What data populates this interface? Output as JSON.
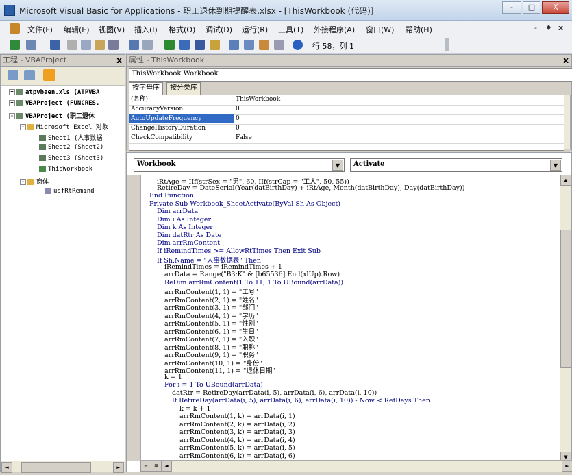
{
  "window": {
    "title": "Microsoft Visual Basic for Applications - 职工退休到期提醒表.xlsx - [ThisWorkbook (代码)]",
    "minimize": "-",
    "maximize": "□",
    "close": "X"
  },
  "menu": {
    "items": [
      "文件(F)",
      "编辑(E)",
      "视图(V)",
      "插入(I)",
      "格式(O)",
      "调试(D)",
      "运行(R)",
      "工具(T)",
      "外接程序(A)",
      "窗口(W)",
      "帮助(H)"
    ],
    "mdi_min": "-",
    "mdi_restore": "♦",
    "mdi_close": "x"
  },
  "toolbar": {
    "position_text": "行 58，列 1"
  },
  "project": {
    "header": "工程 - VBAProject",
    "close": "x",
    "nodes": [
      {
        "text": "atpvbaen.xls (ATPVBA",
        "bold": true
      },
      {
        "text": "VBAProject (FUNCRES.",
        "bold": true
      },
      {
        "text": "VBAProject (职工退休",
        "bold": true
      },
      {
        "text": "Microsoft Excel 对象",
        "bold": false
      },
      {
        "text": "Sheet1 (人事数据",
        "bold": false
      },
      {
        "text": "Sheet2 (Sheet2)",
        "bold": false
      },
      {
        "text": "Sheet3 (Sheet3)",
        "bold": false
      },
      {
        "text": "ThisWorkbook",
        "bold": false
      },
      {
        "text": "窗体",
        "bold": false
      },
      {
        "text": "usfRtRemind",
        "bold": false
      }
    ]
  },
  "properties": {
    "header": "属性 - ThisWorkbook",
    "close": "x",
    "object": "ThisWorkbook Workbook",
    "tabs": [
      "按字母序",
      "按分类序"
    ],
    "rows": [
      {
        "key": "(名称)",
        "value": "ThisWorkbook"
      },
      {
        "key": "AccuracyVersion",
        "value": "0"
      },
      {
        "key": "AutoUpdateFrequency",
        "value": "0"
      },
      {
        "key": "ChangeHistoryDuration",
        "value": "0"
      },
      {
        "key": "CheckCompatibility",
        "value": "False"
      }
    ]
  },
  "code": {
    "object_combo": "Workbook",
    "proc_combo": "Activate",
    "lines": [
      {
        "indent": 2,
        "text": "iRtAge = IIf(strSex = \"男\", 60, IIf(strCap = \"工人\", 50, 55))"
      },
      {
        "indent": 2,
        "text": "RetireDay = DateSerial(Year(datBirthDay) + iRtAge, Month(datBirthDay), Day(datBirthDay))"
      },
      {
        "indent": 1,
        "text": "End Function"
      },
      {
        "indent": 1,
        "text": "Private Sub Workbook_SheetActivate(ByVal Sh As Object)"
      },
      {
        "indent": 2,
        "text": "Dim arrData"
      },
      {
        "indent": 2,
        "text": "Dim i As Integer"
      },
      {
        "indent": 2,
        "text": "Dim k As Integer"
      },
      {
        "indent": 2,
        "text": "Dim datRtr As Date"
      },
      {
        "indent": 2,
        "text": "Dim arrRmContent"
      },
      {
        "indent": 2,
        "text": "If iRemindTimes >= AllowRtTimes Then Exit Sub"
      },
      {
        "indent": 2,
        "text": "If Sh.Name = \"人事数据表\" Then"
      },
      {
        "indent": 3,
        "text": "iRemindTimes = iRemindTimes + 1"
      },
      {
        "indent": 3,
        "text": "arrData = Range(\"B3:K\" & [b65536].End(xlUp).Row)"
      },
      {
        "indent": 3,
        "text": "ReDim arrRmContent(1 To 11, 1 To UBound(arrData))"
      },
      {
        "indent": 3,
        "text": "arrRmContent(1, 1) = \"工号\""
      },
      {
        "indent": 3,
        "text": "arrRmContent(2, 1) = \"姓名\""
      },
      {
        "indent": 3,
        "text": "arrRmContent(3, 1) = \"部门\""
      },
      {
        "indent": 3,
        "text": "arrRmContent(4, 1) = \"学历\""
      },
      {
        "indent": 3,
        "text": "arrRmContent(5, 1) = \"性别\""
      },
      {
        "indent": 3,
        "text": "arrRmContent(6, 1) = \"生日\""
      },
      {
        "indent": 3,
        "text": "arrRmContent(7, 1) = \"入职\""
      },
      {
        "indent": 3,
        "text": "arrRmContent(8, 1) = \"职称\""
      },
      {
        "indent": 3,
        "text": "arrRmContent(9, 1) = \"职务\""
      },
      {
        "indent": 3,
        "text": "arrRmContent(10, 1) = \"身份\""
      },
      {
        "indent": 3,
        "text": "arrRmContent(11, 1) = \"退休日期\""
      },
      {
        "indent": 3,
        "text": "k = 1"
      },
      {
        "indent": 3,
        "text": "For i = 1 To UBound(arrData)"
      },
      {
        "indent": 4,
        "text": "datRtr = RetireDay(arrData(i, 5), arrData(i, 6), arrData(i, 10))"
      },
      {
        "indent": 4,
        "text": "If RetireDay(arrData(i, 5), arrData(i, 6), arrData(i, 10)) - Now < RefDays Then"
      },
      {
        "indent": 5,
        "text": "k = k + 1"
      },
      {
        "indent": 5,
        "text": "arrRmContent(1, k) = arrData(i, 1)"
      },
      {
        "indent": 5,
        "text": "arrRmContent(2, k) = arrData(i, 2)"
      },
      {
        "indent": 5,
        "text": "arrRmContent(3, k) = arrData(i, 3)"
      },
      {
        "indent": 5,
        "text": "arrRmContent(4, k) = arrData(i, 4)"
      },
      {
        "indent": 5,
        "text": "arrRmContent(5, k) = arrData(i, 5)"
      },
      {
        "indent": 5,
        "text": "arrRmContent(6, k) = arrData(i, 6)"
      }
    ]
  }
}
